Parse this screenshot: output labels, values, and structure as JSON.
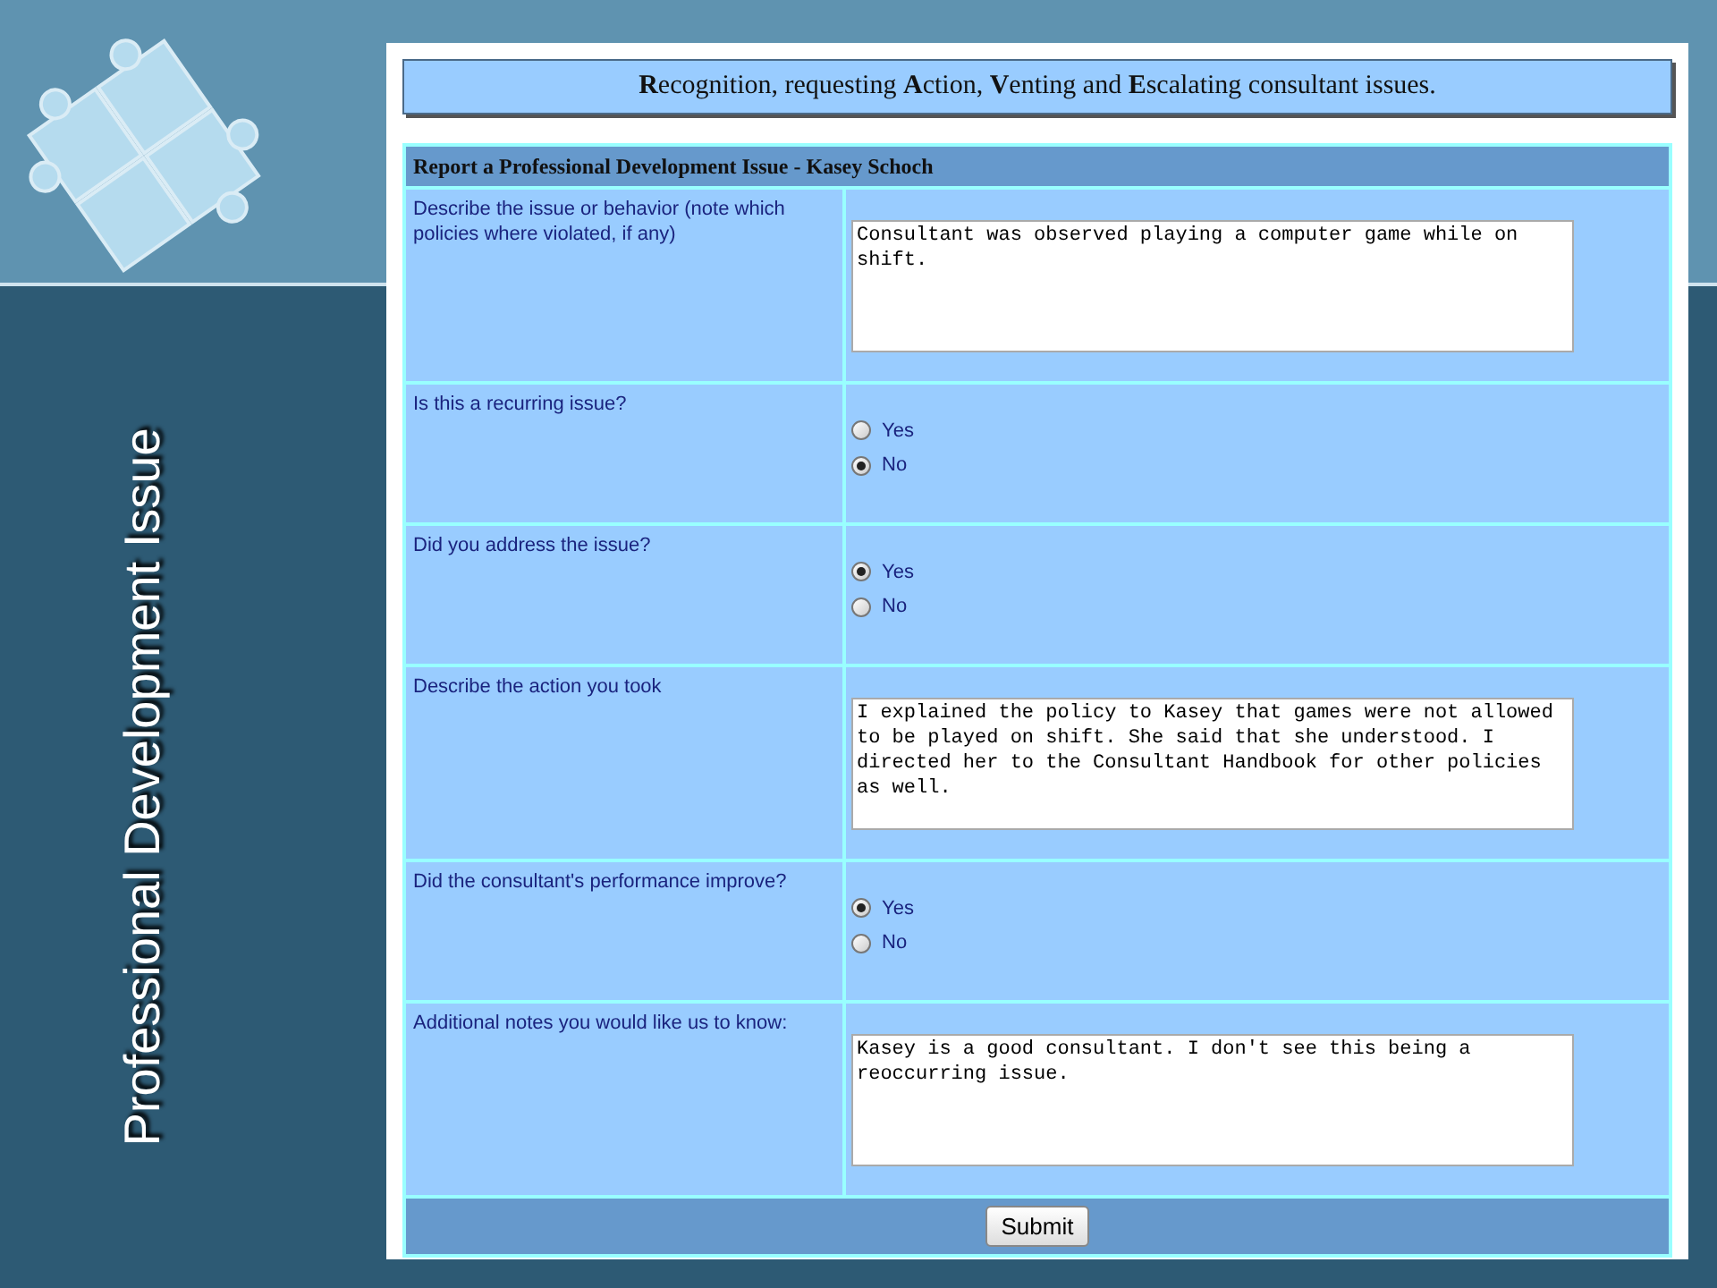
{
  "slide_title": "Professional Development Issue",
  "banner": "**R**ecognition, requesting **A**ction, **V**enting and **E**scalating consultant issues.",
  "form": {
    "header": "Report a Professional Development Issue - Kasey Schoch",
    "rows": [
      {
        "kind": "text",
        "label": "Describe the issue or behavior (note which policies where violated, if any)",
        "value": "Consultant was observed playing a computer game while on shift."
      },
      {
        "kind": "radio",
        "label": "Is this a recurring issue?",
        "options": [
          {
            "label": "Yes",
            "selected": false
          },
          {
            "label": "No",
            "selected": true
          }
        ]
      },
      {
        "kind": "radio",
        "label": "Did you address the issue?",
        "options": [
          {
            "label": "Yes",
            "selected": true
          },
          {
            "label": "No",
            "selected": false
          }
        ]
      },
      {
        "kind": "text",
        "label": "Describe the action you took",
        "value": "I explained the policy to Kasey that games were not allowed to be played on shift. She said that she understood. I directed her to the Consultant Handbook for other policies as well."
      },
      {
        "kind": "radio",
        "label": "Did the consultant's performance improve?",
        "options": [
          {
            "label": "Yes",
            "selected": true
          },
          {
            "label": "No",
            "selected": false
          }
        ]
      },
      {
        "kind": "text",
        "label": "Additional notes you would like us to know:",
        "value": "Kasey is a good consultant. I don't see this being a reoccurring issue."
      }
    ],
    "submit": "Submit"
  }
}
